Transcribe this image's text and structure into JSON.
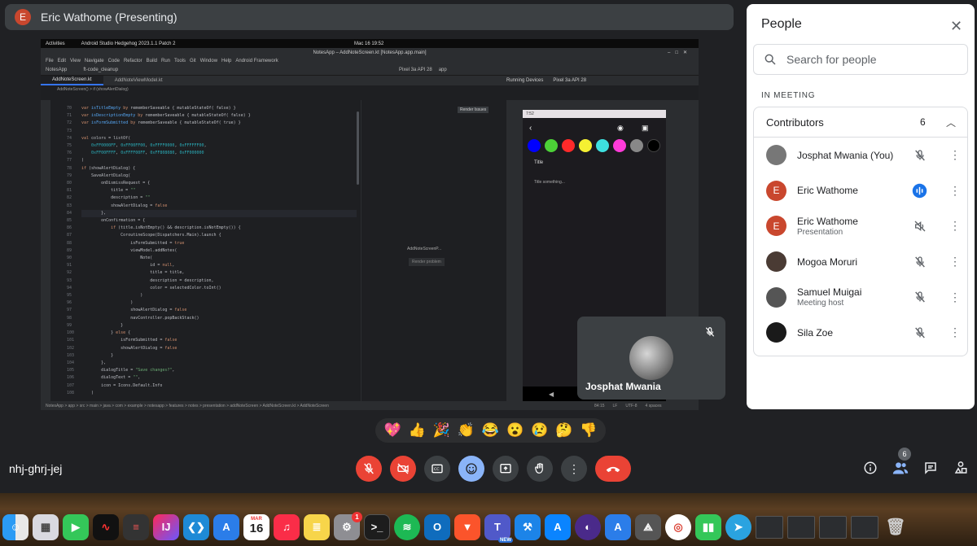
{
  "presenter": {
    "initial": "E",
    "label": "Eric Wathome (Presenting)"
  },
  "shared_screen": {
    "gnome": {
      "activities": "Activities",
      "app": "Android Studio Hedgehog 2023.1.1 Patch 2",
      "clock": "Mac 16 19:52"
    },
    "window_title": "NotesApp – AddNoteScreen.kt [NotesApp.app.main]",
    "menu": [
      "File",
      "Edit",
      "View",
      "Navigate",
      "Code",
      "Refactor",
      "Build",
      "Run",
      "Tools",
      "Git",
      "Window",
      "Help",
      "Android Framework"
    ],
    "toolbar": {
      "project": "NotesApp",
      "branch": "ft-code_cleanup",
      "device": "Pixel 3a API 28",
      "config": "app"
    },
    "tabs": [
      "AddNoteScreen.kt",
      "AddNoteViewModel.kt"
    ],
    "right_tabs": [
      "Running Devices",
      "Pixel 3a API 28"
    ],
    "breadcrumb_top": "AddNoteScreen()  >  if (showAlertDialog)",
    "line_numbers": "70\n71\n72\n73\n74\n75\n76\n77\n78\n79\n80\n81\n82\n83\n84\n85\n86\n87\n88\n89\n90\n91\n92\n93\n94\n95\n96\n97\n98\n99\n100\n101\n102\n103\n104\n105\n106\n107\n108",
    "render_issues": "Render Issues",
    "preview_name": "AddNoteScreenP...",
    "preview_problem": "Render problem",
    "phone": {
      "time": "7:52",
      "title_label": "Title",
      "desc_placeholder": "Title something...",
      "colors": [
        "#0000ff",
        "#4cd137",
        "#ff2a2a",
        "#f5f032",
        "#3ee0e0",
        "#ff3bd9",
        "#888888",
        "#000000"
      ]
    },
    "status_path": "NotesApp > app > src > main > java > com > example > notesapp > features > notes > presentation > addNoteScreen > AddNoteScreen.kt > AddNoteScreen",
    "status_right": [
      "84:15",
      "LF",
      "UTF-8",
      "4 spaces"
    ]
  },
  "self_tile": {
    "name": "Josphat Mwania"
  },
  "reactions": [
    "💖",
    "👍",
    "🎉",
    "👏",
    "😂",
    "😮",
    "😢",
    "🤔",
    "👎"
  ],
  "meeting_code": "nhj-ghrj-jej",
  "people": {
    "title": "People",
    "search_placeholder": "Search for people",
    "section_label": "IN MEETING",
    "group_label": "Contributors",
    "group_count": "6",
    "participants_badge": "6",
    "participants": [
      {
        "name": "Josphat Mwania (You)",
        "sub": "",
        "mic": "muted",
        "avatar_color": "#777777"
      },
      {
        "name": "Eric Wathome",
        "sub": "",
        "mic": "speaking",
        "avatar_color": "#c9472e",
        "initial": "E"
      },
      {
        "name": "Eric Wathome",
        "sub": "Presentation",
        "mic": "presentation",
        "avatar_color": "#c9472e",
        "initial": "E"
      },
      {
        "name": "Mogoa Moruri",
        "sub": "",
        "mic": "muted",
        "avatar_color": "#4a3b34"
      },
      {
        "name": "Samuel Muigai",
        "sub": "Meeting host",
        "mic": "muted",
        "avatar_color": "#555555"
      },
      {
        "name": "Sila Zoe",
        "sub": "",
        "mic": "muted",
        "avatar_color": "#1a1a1a"
      }
    ]
  },
  "dock": {
    "calendar": {
      "month": "MAR",
      "day": "16"
    },
    "settings_badge": "1",
    "teams_badge": "NEW",
    "apps": [
      "finder",
      "launchpad",
      "facetime",
      "voice-memos",
      "database",
      "intellij",
      "vscode",
      "xcode-instruments",
      "calendar",
      "music",
      "notes",
      "system-settings",
      "terminal",
      "spotify",
      "outlook",
      "brave",
      "teams",
      "xcode",
      "app-store",
      "tor",
      "simulator",
      "instruments",
      "chrome",
      "numbers",
      "telegram"
    ]
  }
}
